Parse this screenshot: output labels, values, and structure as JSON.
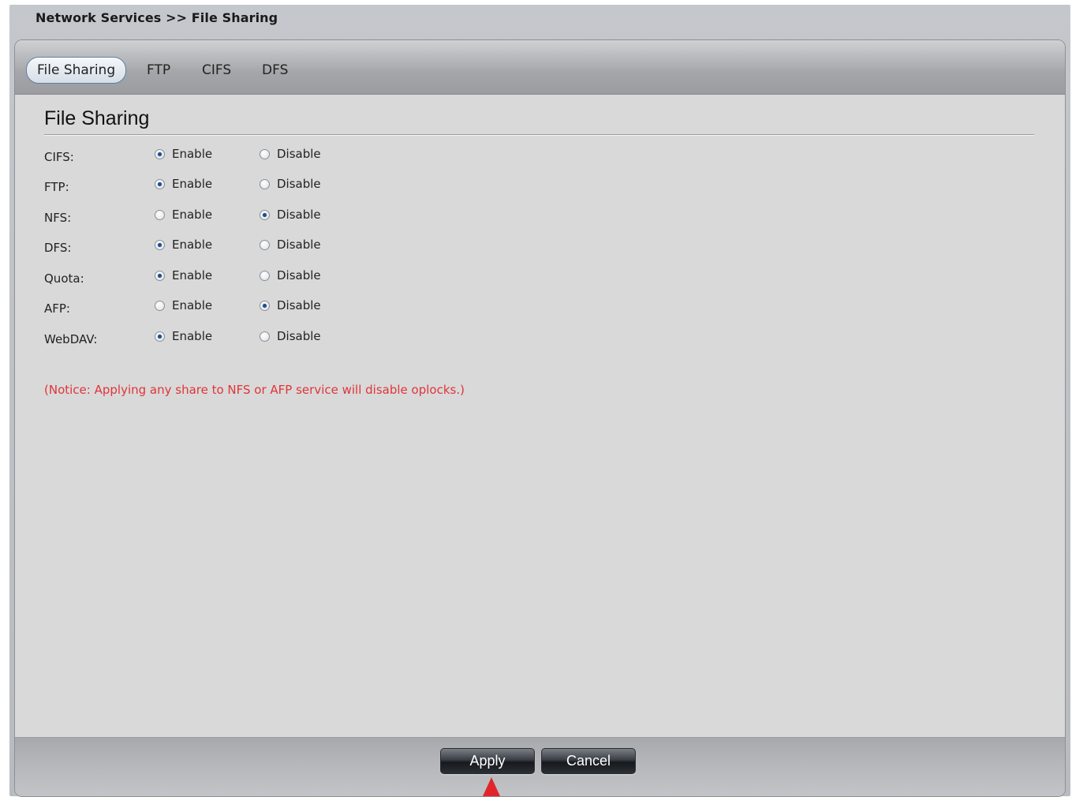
{
  "header": {
    "breadcrumb": "Network Services >> File Sharing"
  },
  "tabs": [
    {
      "label": "File Sharing",
      "active": true
    },
    {
      "label": "FTP",
      "active": false
    },
    {
      "label": "CIFS",
      "active": false
    },
    {
      "label": "DFS",
      "active": false
    }
  ],
  "section": {
    "title": "File Sharing"
  },
  "options": {
    "enable_label": "Enable",
    "disable_label": "Disable"
  },
  "settings": [
    {
      "label": "CIFS:",
      "value": "Enable"
    },
    {
      "label": "FTP:",
      "value": "Enable"
    },
    {
      "label": "NFS:",
      "value": "Disable"
    },
    {
      "label": "DFS:",
      "value": "Enable"
    },
    {
      "label": "Quota:",
      "value": "Enable"
    },
    {
      "label": "AFP:",
      "value": "Disable"
    },
    {
      "label": "WebDAV:",
      "value": "Enable"
    }
  ],
  "notice": "(Notice: Applying any share to NFS or AFP service will disable oplocks.)",
  "footer": {
    "apply_label": "Apply",
    "cancel_label": "Cancel"
  },
  "colors": {
    "notice": "#e0343a",
    "pointer": "#e0262b",
    "radio_checked": "#1e4f86"
  }
}
